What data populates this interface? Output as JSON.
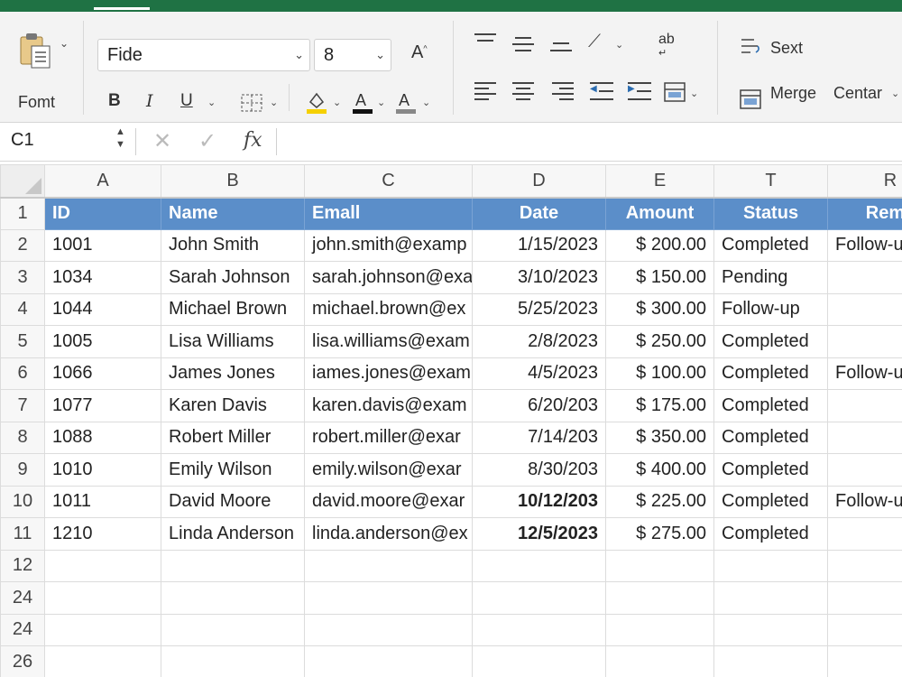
{
  "ribbon": {
    "clipboard_label": "Fomt",
    "font_name": "Fide",
    "font_size": "8",
    "grow_font": "A",
    "format_buttons": [
      "B",
      "I",
      "U"
    ],
    "wrap_text": "Sext",
    "merge_label": "Merge",
    "center_label": "Centar",
    "orientation_icon": "ab",
    "fill_color": "#f5d000",
    "font_color": "#111111",
    "font_color2": "#888888"
  },
  "formula_bar": {
    "name_box": "C1",
    "fx": "fx",
    "cancel": "✕",
    "enter": "✓",
    "formula": ""
  },
  "sheet": {
    "columns": [
      "A",
      "B",
      "C",
      "D",
      "E",
      "T",
      "R"
    ],
    "header_row": {
      "row": "1",
      "cells": [
        "ID",
        "Name",
        "Emall",
        "Date",
        "Amount",
        "Status",
        "Rema"
      ]
    },
    "rows": [
      {
        "row": "2",
        "cells": [
          "1001",
          "John Smith",
          "john.smith@examp",
          "1/15/2023",
          "$ 200.00",
          "Completed",
          "Follow-u"
        ]
      },
      {
        "row": "3",
        "cells": [
          "1034",
          "Sarah Johnson",
          "sarah.johnson@exa",
          "3/10/2023",
          "$ 150.00",
          "Pending",
          ""
        ]
      },
      {
        "row": "4",
        "cells": [
          "1044",
          "Michael Brown",
          "michael.brown@ex",
          "5/25/2023",
          "$ 300.00",
          "Follow-up",
          ""
        ]
      },
      {
        "row": "5",
        "cells": [
          "1005",
          "Lisa Williams",
          "lisa.williams@exam",
          "2/8/2023",
          "$ 250.00",
          "Completed",
          ""
        ]
      },
      {
        "row": "6",
        "cells": [
          "1066",
          "James Jones",
          "iames.jones@exam",
          "4/5/2023",
          "$ 100.00",
          "Completed",
          "Follow-u"
        ]
      },
      {
        "row": "7",
        "cells": [
          "1077",
          "Karen Davis",
          "karen.davis@exam",
          "6/20/203",
          "$ 175.00",
          "Completed",
          ""
        ]
      },
      {
        "row": "8",
        "cells": [
          "1088",
          "Robert Miller",
          "robert.miller@exar",
          "7/14/203",
          "$ 350.00",
          "Completed",
          ""
        ]
      },
      {
        "row": "9",
        "cells": [
          "1010",
          "Emily Wilson",
          "emily.wilson@exar",
          "8/30/203",
          "$ 400.00",
          "Completed",
          ""
        ]
      },
      {
        "row": "10",
        "cells": [
          "1011",
          "David Moore",
          "david.moore@exar",
          "10/12/203",
          "$ 225.00",
          "Completed",
          "Follow-u"
        ]
      },
      {
        "row": "11",
        "cells": [
          "1210",
          "Linda Anderson",
          "linda.anderson@ex",
          "12/5/2023",
          "$ 275.00",
          "Completed",
          ""
        ]
      }
    ],
    "empty_rows": [
      "12",
      "24",
      "24",
      "26"
    ]
  }
}
